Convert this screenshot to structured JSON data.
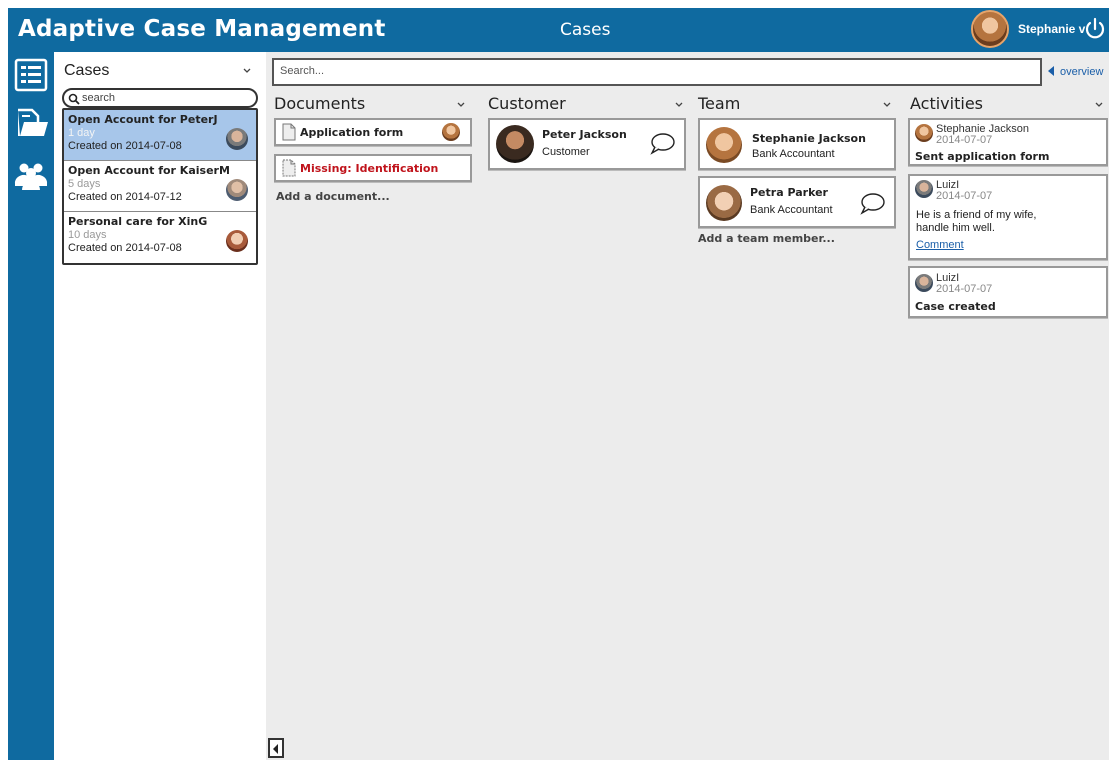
{
  "header": {
    "app_title": "Adaptive Case Management",
    "page_title": "Cases",
    "user_name": "Stephanie v"
  },
  "nav": {
    "icons": [
      "task-list-icon",
      "documents-icon",
      "team-icon"
    ]
  },
  "cases": {
    "heading": "Cases",
    "search_placeholder": "search",
    "items": [
      {
        "title": "Open Account for PeterJ",
        "age": "1 day",
        "created": "Created on 2014-07-08",
        "selected": true
      },
      {
        "title": "Open Account for KaiserM",
        "age": "5 days",
        "created": "Created on 2014-07-12",
        "selected": false
      },
      {
        "title": "Personal care for XinG",
        "age": "10 days",
        "created": "Created on 2014-07-08",
        "selected": false
      }
    ]
  },
  "main": {
    "search_placeholder": "Search...",
    "overview_label": "overview"
  },
  "documents": {
    "heading": "Documents",
    "items": [
      {
        "label": "Application form"
      },
      {
        "label": "Missing: Identification"
      }
    ],
    "add_label": "Add a document..."
  },
  "customer": {
    "heading": "Customer",
    "name": "Peter Jackson",
    "role": "Customer"
  },
  "team": {
    "heading": "Team",
    "members": [
      {
        "name": "Stephanie Jackson",
        "role": "Bank Accountant"
      },
      {
        "name": "Petra Parker",
        "role": "Bank Accountant"
      }
    ],
    "add_label": "Add a team member..."
  },
  "activities": {
    "heading": "Activities",
    "items": [
      {
        "name": "Stephanie Jackson",
        "date": "2014-07-07",
        "text": "Sent application form"
      },
      {
        "name": "LuizI",
        "date": "2014-07-07",
        "body_line1": "He is a friend of my wife,",
        "body_line2": "handle him well.",
        "link": "Comment"
      },
      {
        "name": "LuizI",
        "date": "2014-07-07",
        "text": "Case created"
      }
    ]
  },
  "colors": {
    "brand": "#0f6aa0",
    "selected_case": "#a7c6ea",
    "missing": "#c0141c",
    "link": "#1a5ea8"
  }
}
